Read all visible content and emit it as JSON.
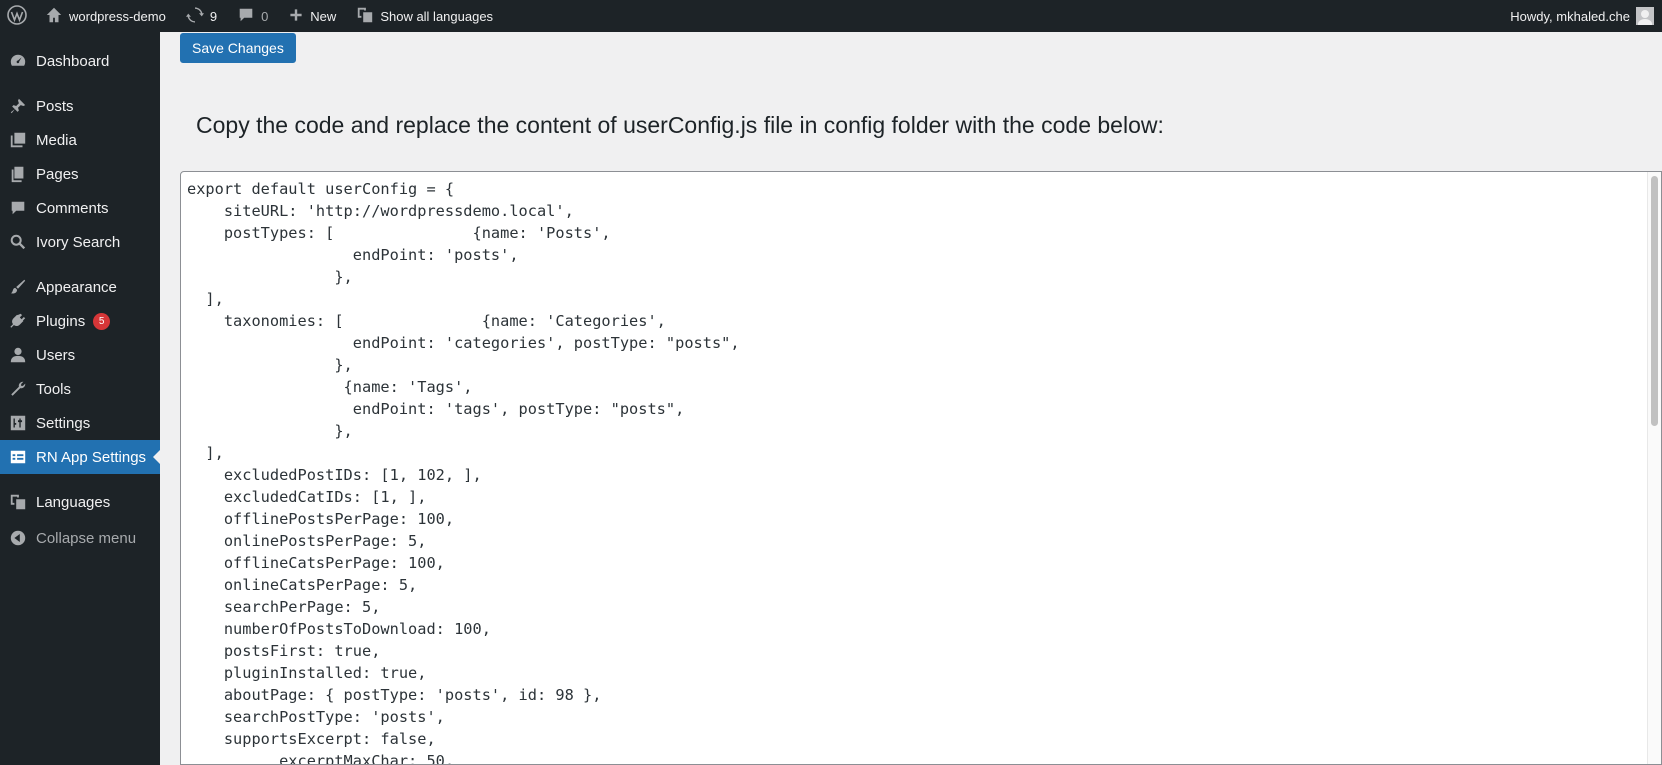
{
  "admin_bar": {
    "site_name": "wordpress-demo",
    "updates_count": "9",
    "comments_count": "0",
    "new_label": "New",
    "languages_label": "Show all languages",
    "howdy": "Howdy, mkhaled.che",
    "icons": [
      "wordpress-logo-icon",
      "home-icon",
      "updates-icon",
      "comment-icon",
      "plus-icon",
      "translation-icon",
      "avatar"
    ]
  },
  "sidebar": {
    "items": [
      {
        "label": "Dashboard",
        "icon": "dashboard-icon"
      },
      {
        "label": "Posts",
        "icon": "pin-icon"
      },
      {
        "label": "Media",
        "icon": "media-icon"
      },
      {
        "label": "Pages",
        "icon": "pages-icon"
      },
      {
        "label": "Comments",
        "icon": "comment-icon"
      },
      {
        "label": "Ivory Search",
        "icon": "search-icon"
      },
      {
        "label": "Appearance",
        "icon": "brush-icon"
      },
      {
        "label": "Plugins",
        "icon": "plugin-icon",
        "badge": "5"
      },
      {
        "label": "Users",
        "icon": "user-icon"
      },
      {
        "label": "Tools",
        "icon": "wrench-icon"
      },
      {
        "label": "Settings",
        "icon": "sliders-icon"
      },
      {
        "label": "RN App Settings",
        "icon": "table-icon",
        "current": true
      },
      {
        "label": "Languages",
        "icon": "translation-icon"
      },
      {
        "label": "Collapse menu",
        "icon": "collapse-icon"
      }
    ]
  },
  "main": {
    "save_label": "Save Changes",
    "heading": "Copy the code and replace the content of userConfig.js file in config folder with the code below:",
    "code": "export default userConfig = {\n    siteURL: 'http://wordpressdemo.local',\n    postTypes: [               {name: 'Posts',\n                  endPoint: 'posts',\n                },\n  ],\n    taxonomies: [               {name: 'Categories',\n                  endPoint: 'categories', postType: \"posts\",\n                },\n                 {name: 'Tags',\n                  endPoint: 'tags', postType: \"posts\",\n                },\n  ],\n    excludedPostIDs: [1, 102, ],\n    excludedCatIDs: [1, ],\n    offlinePostsPerPage: 100,\n    onlinePostsPerPage: 5,\n    offlineCatsPerPage: 100,\n    onlineCatsPerPage: 5,\n    searchPerPage: 5,\n    numberOfPostsToDownload: 100,\n    postsFirst: true,\n    pluginInstalled: true,\n    aboutPage: { postType: 'posts', id: 98 },\n    searchPostType: 'posts',\n    supportsExcerpt: false,\n          excerptMaxChar: 50,"
  },
  "colors": {
    "admin_dark": "#1d2327",
    "accent": "#2271b1",
    "badge": "#d63638",
    "background": "#f0f0f1"
  }
}
